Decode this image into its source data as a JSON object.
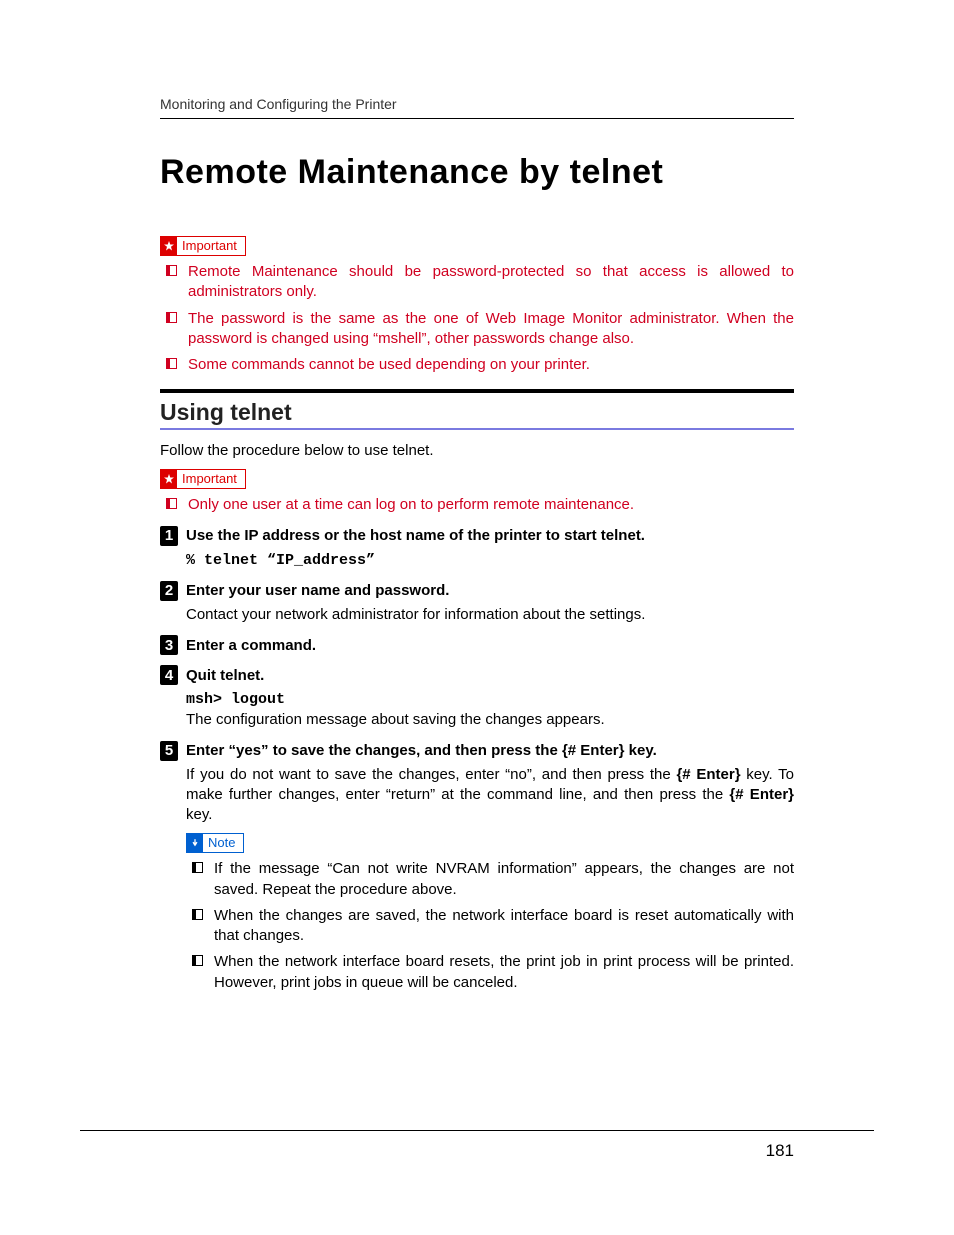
{
  "runningHead": "Monitoring and Configuring the Printer",
  "title": "Remote Maintenance by telnet",
  "labels": {
    "important": "Important",
    "note": "Note"
  },
  "importantTop": [
    "Remote Maintenance should be password-protected so that access is allowed to administrators only.",
    "The password is the same as the one of Web Image Monitor administrator. When the password is changed using “mshell”, other passwords change also.",
    "Some commands cannot be used depending on your printer."
  ],
  "section": {
    "title": "Using telnet",
    "lead": "Follow the procedure below to use telnet.",
    "important": [
      "Only one user at a time can log on to perform remote maintenance."
    ],
    "steps": [
      {
        "num": "1",
        "title": "Use the IP address or the host name of the printer to start telnet.",
        "code": "% telnet “IP_address”"
      },
      {
        "num": "2",
        "title": "Enter your user name and password.",
        "body": "Contact your network administrator for information about the settings."
      },
      {
        "num": "3",
        "title": "Enter a command."
      },
      {
        "num": "4",
        "title": "Quit telnet.",
        "code": "msh> logout",
        "body": "The configuration message about saving the changes appears."
      },
      {
        "num": "5",
        "titlePre": "Enter “yes” to save the changes, and then press the ",
        "titleKey": "# Enter",
        "titlePost": " key.",
        "body5a": "If you do not want to save the changes, enter “no”, and then press the ",
        "body5key1": "# Enter",
        "body5b": " key. To make further changes, enter “return” at the command line, and then press the ",
        "body5key2": "# Enter",
        "body5c": " key."
      }
    ],
    "notes": [
      "If the message “Can not write NVRAM information” appears, the changes are not saved. Repeat the procedure above.",
      "When the changes are saved, the network interface board is reset automatically with that changes.",
      "When the network interface board resets, the print job in print process will be printed. However, print jobs in queue will be canceled."
    ]
  },
  "pageNumber": "181"
}
